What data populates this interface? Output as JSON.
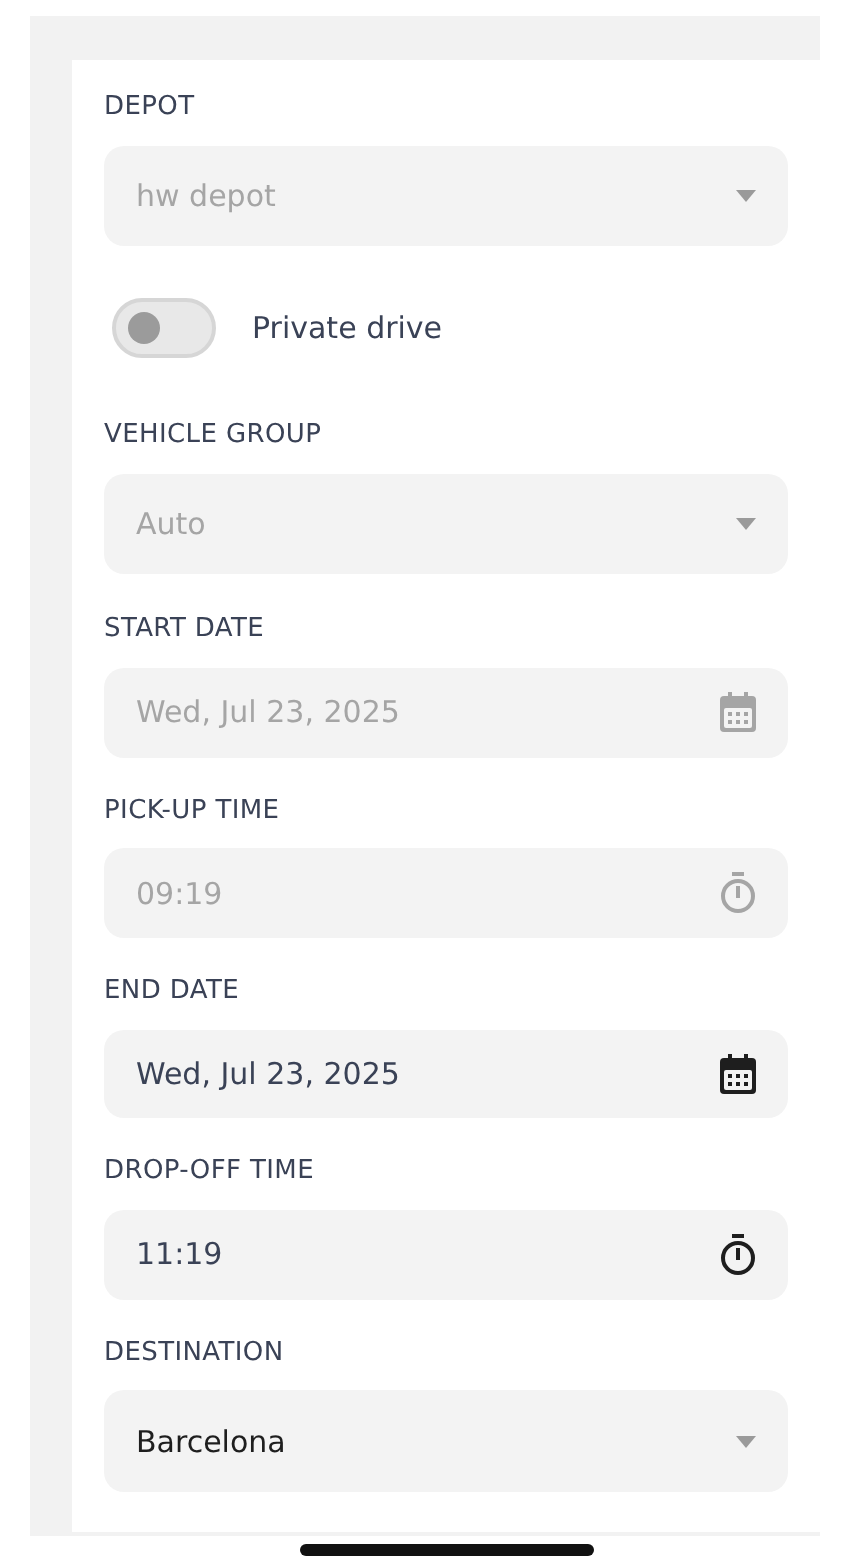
{
  "form": {
    "fields": [
      {
        "kind": "select",
        "label": "DEPOT",
        "value": "hw depot",
        "disabled": true
      },
      {
        "kind": "toggle",
        "label": "Private drive",
        "on": false
      },
      {
        "kind": "select",
        "label": "VEHICLE GROUP",
        "value": "Auto",
        "disabled": true
      },
      {
        "kind": "date",
        "label": "START DATE",
        "value": "Wed, Jul 23, 2025",
        "disabled": true
      },
      {
        "kind": "time",
        "label": "PICK-UP TIME",
        "value": "09:19",
        "disabled": true
      },
      {
        "kind": "date",
        "label": "END DATE",
        "value": "Wed, Jul 23, 2025",
        "disabled": false
      },
      {
        "kind": "time",
        "label": "DROP-OFF TIME",
        "value": "11:19",
        "disabled": false
      },
      {
        "kind": "select",
        "label": "DESTINATION",
        "value": "Barcelona",
        "disabled": false
      }
    ]
  }
}
